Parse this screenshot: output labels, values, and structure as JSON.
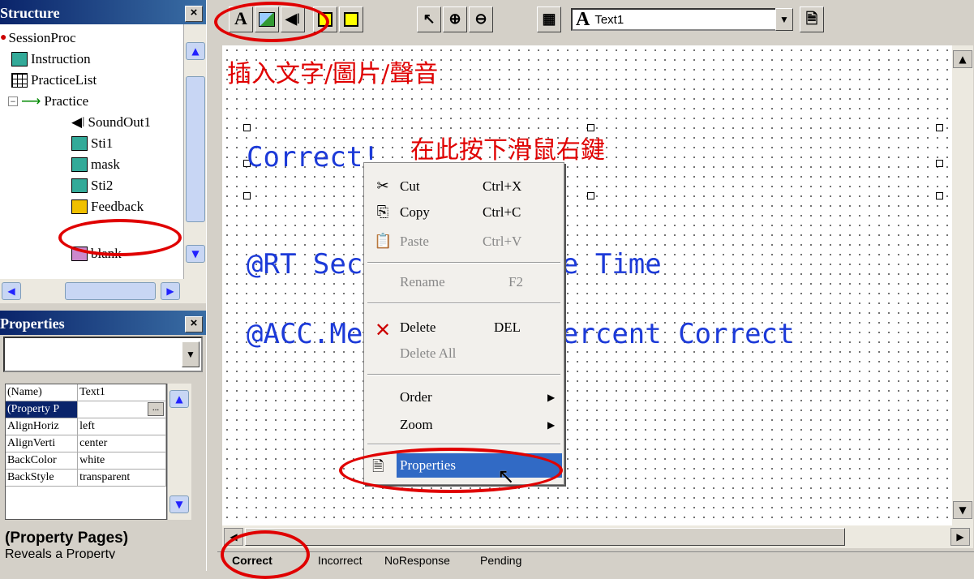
{
  "structure": {
    "title": "Structure",
    "close": "×",
    "tree": [
      "SessionProc",
      "Instruction",
      "PracticeList",
      "Practice",
      "SoundOut1",
      "Sti1",
      "mask",
      "Sti2",
      "Feedback",
      "blank"
    ]
  },
  "properties": {
    "title": "Properties",
    "close": "×",
    "rows": [
      {
        "k": "(Name)",
        "v": "Text1"
      },
      {
        "k": "(Property P",
        "v": ""
      },
      {
        "k": "AlignHoriz",
        "v": "left"
      },
      {
        "k": "AlignVerti",
        "v": "center"
      },
      {
        "k": "BackColor",
        "v": "white"
      },
      {
        "k": "BackStyle",
        "v": "transparent"
      }
    ],
    "desc_title": "(Property Pages)",
    "desc_text": "Reveals a Property"
  },
  "toolbar": {
    "text_tool": "A",
    "font_glyph": "A",
    "object_combo": "Text1"
  },
  "annotations": {
    "insert": "插入文字/圖片/聲音",
    "right_click": "在此按下滑鼠右鍵"
  },
  "canvas": {
    "line1": "Correct!",
    "line2": "@RT Seconds Response Time",
    "line3": "@ACC.Mean Average Percent Correct"
  },
  "menu": {
    "cut": "Cut",
    "cut_sc": "Ctrl+X",
    "copy": "Copy",
    "copy_sc": "Ctrl+C",
    "paste": "Paste",
    "paste_sc": "Ctrl+V",
    "rename": "Rename",
    "rename_sc": "F2",
    "delete": "Delete",
    "delete_sc": "DEL",
    "delete_all": "Delete All",
    "order": "Order",
    "zoom": "Zoom",
    "properties": "Properties"
  },
  "tabs": [
    "Correct",
    "Incorrect",
    "NoResponse",
    "Pending"
  ]
}
